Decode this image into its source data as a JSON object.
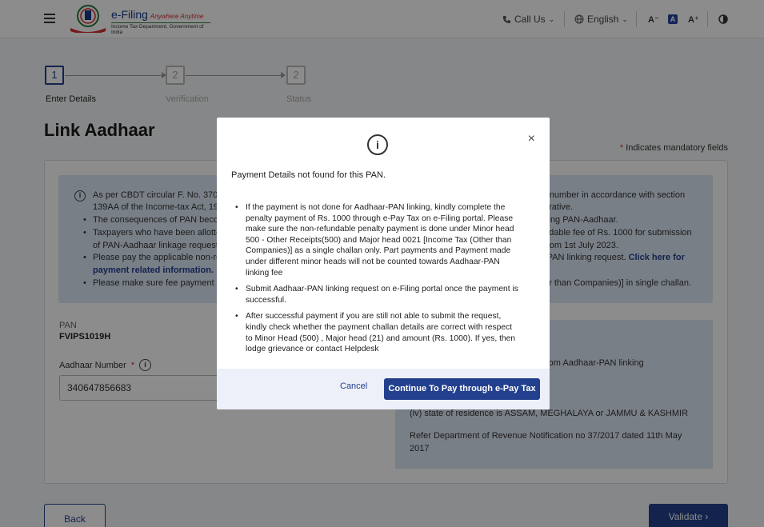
{
  "header": {
    "brand": "e-Filing",
    "tagline": "Anywhere Anytime",
    "subtitle": "Income Tax Department, Government of India",
    "call_us": "Call Us",
    "language": "English",
    "font_decrease": "A⁻",
    "font_normal": "A",
    "font_increase": "A⁺"
  },
  "stepper": {
    "steps": [
      {
        "number": "1",
        "label": "Enter Details"
      },
      {
        "number": "2",
        "label": "Verification"
      },
      {
        "number": "2",
        "label": "Status"
      }
    ]
  },
  "page": {
    "title": "Link Aadhaar",
    "mandatory_star": "*",
    "mandatory_note": "Indicates mandatory fields"
  },
  "info_panel": {
    "line1_left": "As per CBDT circular F. No. 37014",
    "line1_right": "r number in accordance with section",
    "line2_left": "139AA of the Income-tax Act, 196",
    "line2_right": "erative.",
    "line3_left": "The consequences of PAN becom",
    "line3_right": "king PAN-Aadhaar.",
    "line4_left": "Taxpayers who have been allotted",
    "line4_right": "ndable fee of Rs. 1000 for submission",
    "line5_left": "of PAN-Aadhaar linkage request.",
    "line5_right": "from 1st July 2023.",
    "line6_left": "Please pay the applicable non-ref",
    "line6_right": "-PAN linking request.",
    "line6_link": "Click here for",
    "line7_link": "payment related information.",
    "line8_left": "Please make sure fee payment is",
    "line8_right": "er than Companies)] in single challan."
  },
  "form": {
    "pan_label": "PAN",
    "pan_value": "FVIPS1019H",
    "aadhaar_label": "Aadhaar Number",
    "aadhaar_star": "*",
    "aadhaar_value": "340647856683"
  },
  "exempt_panel": {
    "line1": "rom Aadhaar-PAN linking",
    "line2": "(iv) state of residence is ASSAM, MEGHALAYA or JAMMU & KASHMIR",
    "line3": "Refer Department of Revenue Notification no 37/2017 dated 11th May",
    "line4": "2017"
  },
  "actions": {
    "back": "Back",
    "validate": "Validate"
  },
  "modal": {
    "close": "×",
    "heading": "Payment Details not found for this PAN.",
    "items": [
      "If the payment is not done for Aadhaar-PAN linking, kindly complete the penalty payment of Rs. 1000 through e-Pay Tax on e-Filing portal. Please make sure the non-refundable penalty payment is done under Minor head 500 - Other Receipts(500) and Major head 0021 [Income Tax (Other than Companies)] as a single challan only. Part payments and Payment made under different minor heads will not be counted towards Aadhaar-PAN linking fee",
      "Submit Aadhaar-PAN linking request on e-Filing portal once the payment is successful.",
      "After successful payment if you are still not able to submit the request, kindly check whether the payment challan details are correct with respect to Minor Head (500) , Major head (21) and amount (Rs. 1000). If yes, then lodge grievance or contact Helpdesk"
    ],
    "cancel": "Cancel",
    "continue": "Continue To Pay through e-Pay Tax"
  }
}
